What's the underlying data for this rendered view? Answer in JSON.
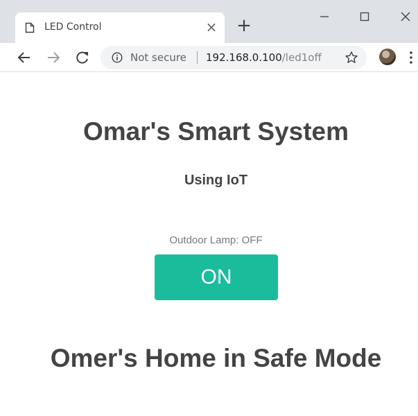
{
  "browser": {
    "tab_title": "LED Control",
    "tab_close_glyph": "×",
    "new_tab_glyph": "+",
    "security_label": "Not secure",
    "url_host": "192.168.0.100",
    "url_path": "/led1off",
    "icons": {
      "favicon": "page-icon",
      "back": "arrow-left-icon",
      "forward": "arrow-right-icon",
      "reload": "reload-icon",
      "info": "info-icon",
      "bookmark": "star-icon",
      "menu": "three-dots-icon"
    }
  },
  "page": {
    "title": "Omar's Smart System",
    "subtitle": "Using IoT",
    "lamp_status": "Outdoor Lamp: OFF",
    "toggle_button": "ON",
    "mode_text": "Omer's Home in Safe Mode"
  },
  "colors": {
    "button": "#1abc9c",
    "heading": "#444444",
    "status_text": "#777777",
    "chrome_bg": "#dee1e6"
  }
}
